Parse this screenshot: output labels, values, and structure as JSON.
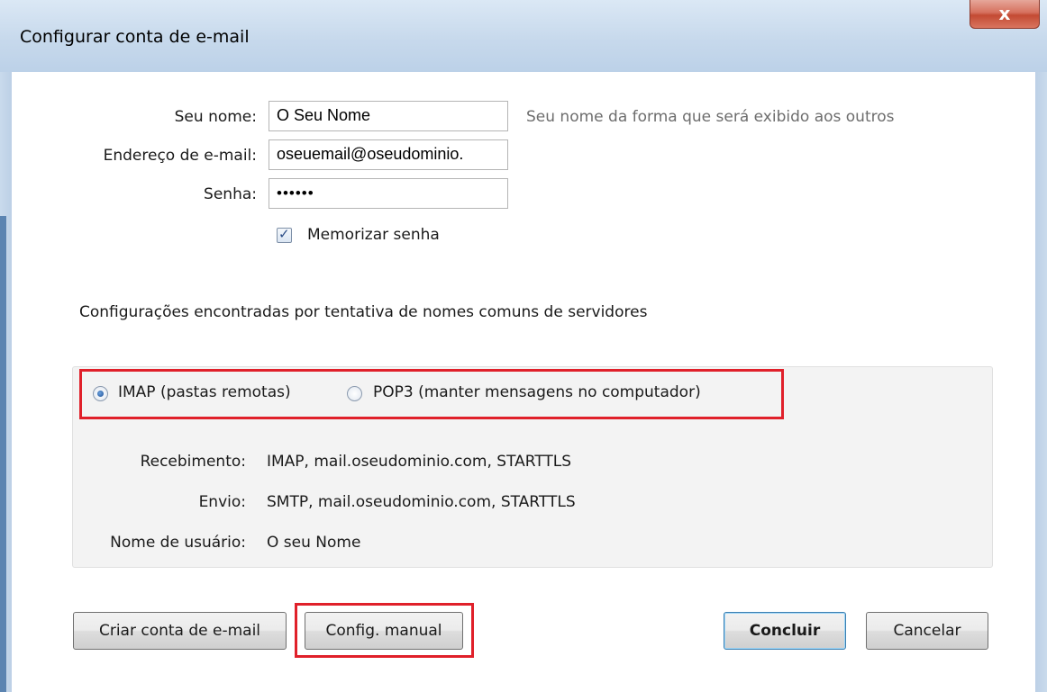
{
  "window": {
    "title": "Configurar conta de e-mail",
    "close_glyph": "x"
  },
  "form": {
    "name_label": "Seu nome:",
    "name_value": "O Seu Nome",
    "name_hint": "Seu nome da forma que será exibido aos outros",
    "email_label": "Endereço de e-mail:",
    "email_value": "oseuemail@oseudominio.",
    "password_label": "Senha:",
    "password_mask": "••••••",
    "remember_label": "Memorizar senha",
    "remember_checked": true
  },
  "status_text": "Configurações encontradas por tentativa de nomes comuns de servidores",
  "protocols": {
    "imap_label": "IMAP (pastas remotas)",
    "pop3_label": "POP3 (manter mensagens no computador)",
    "selected": "IMAP"
  },
  "details": {
    "incoming_label": "Recebimento:",
    "incoming_value": "IMAP, mail.oseudominio.com, STARTTLS",
    "outgoing_label": "Envio:",
    "outgoing_value": "SMTP, mail.oseudominio.com, STARTTLS",
    "username_label": "Nome de usuário:",
    "username_value": "O seu Nome"
  },
  "buttons": {
    "create": "Criar conta de e-mail",
    "manual": "Config. manual",
    "done": "Concluir",
    "cancel": "Cancelar"
  },
  "colors": {
    "highlight": "#e0202a",
    "title_bar": "#c7d9ec",
    "close_button": "#c34a33"
  },
  "icons": [
    "close-icon",
    "checkbox-check-icon",
    "radio-selected-icon",
    "radio-empty-icon"
  ]
}
